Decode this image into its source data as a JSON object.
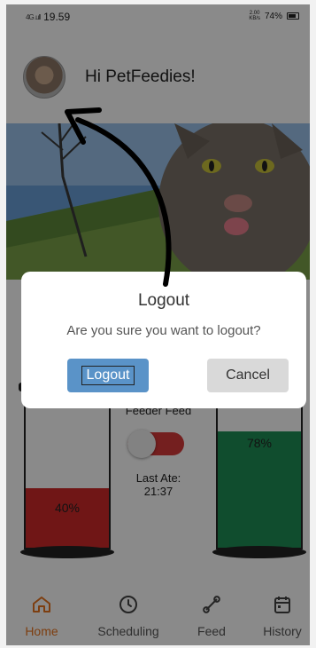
{
  "status_bar": {
    "time": "19.59",
    "signal_text": "4G .ull",
    "network_speed_value": "2.00",
    "network_speed_unit": "KB/s",
    "battery": "74%"
  },
  "header": {
    "greeting": "Hi PetFeedies!",
    "avatar_icon": "cat-avatar"
  },
  "feeder": {
    "title": "Feeder Feed",
    "left_tank_percent": "40%",
    "left_tank_level": 0.4,
    "right_tank_percent": "78%",
    "right_tank_level": 0.78,
    "toggle_on": true,
    "last_ate_label": "Last Ate:",
    "last_ate_time": "21:37",
    "colors": {
      "left_fill": "#cf2a2a",
      "right_fill": "#1f8f55",
      "toggle": "#d63a3a"
    }
  },
  "dialog": {
    "title": "Logout",
    "message": "Are you sure you want to logout?",
    "confirm_label": "Logout",
    "cancel_label": "Cancel",
    "confirm_color": "#5a93c8",
    "cancel_color": "#d9d9d9"
  },
  "tabs": [
    {
      "label": "Home",
      "icon": "home-icon",
      "active": true
    },
    {
      "label": "Scheduling",
      "icon": "clock-icon",
      "active": false
    },
    {
      "label": "Feed",
      "icon": "bone-icon",
      "active": false
    },
    {
      "label": "History",
      "icon": "calendar-icon",
      "active": false
    }
  ],
  "accent_color": "#e8741e"
}
